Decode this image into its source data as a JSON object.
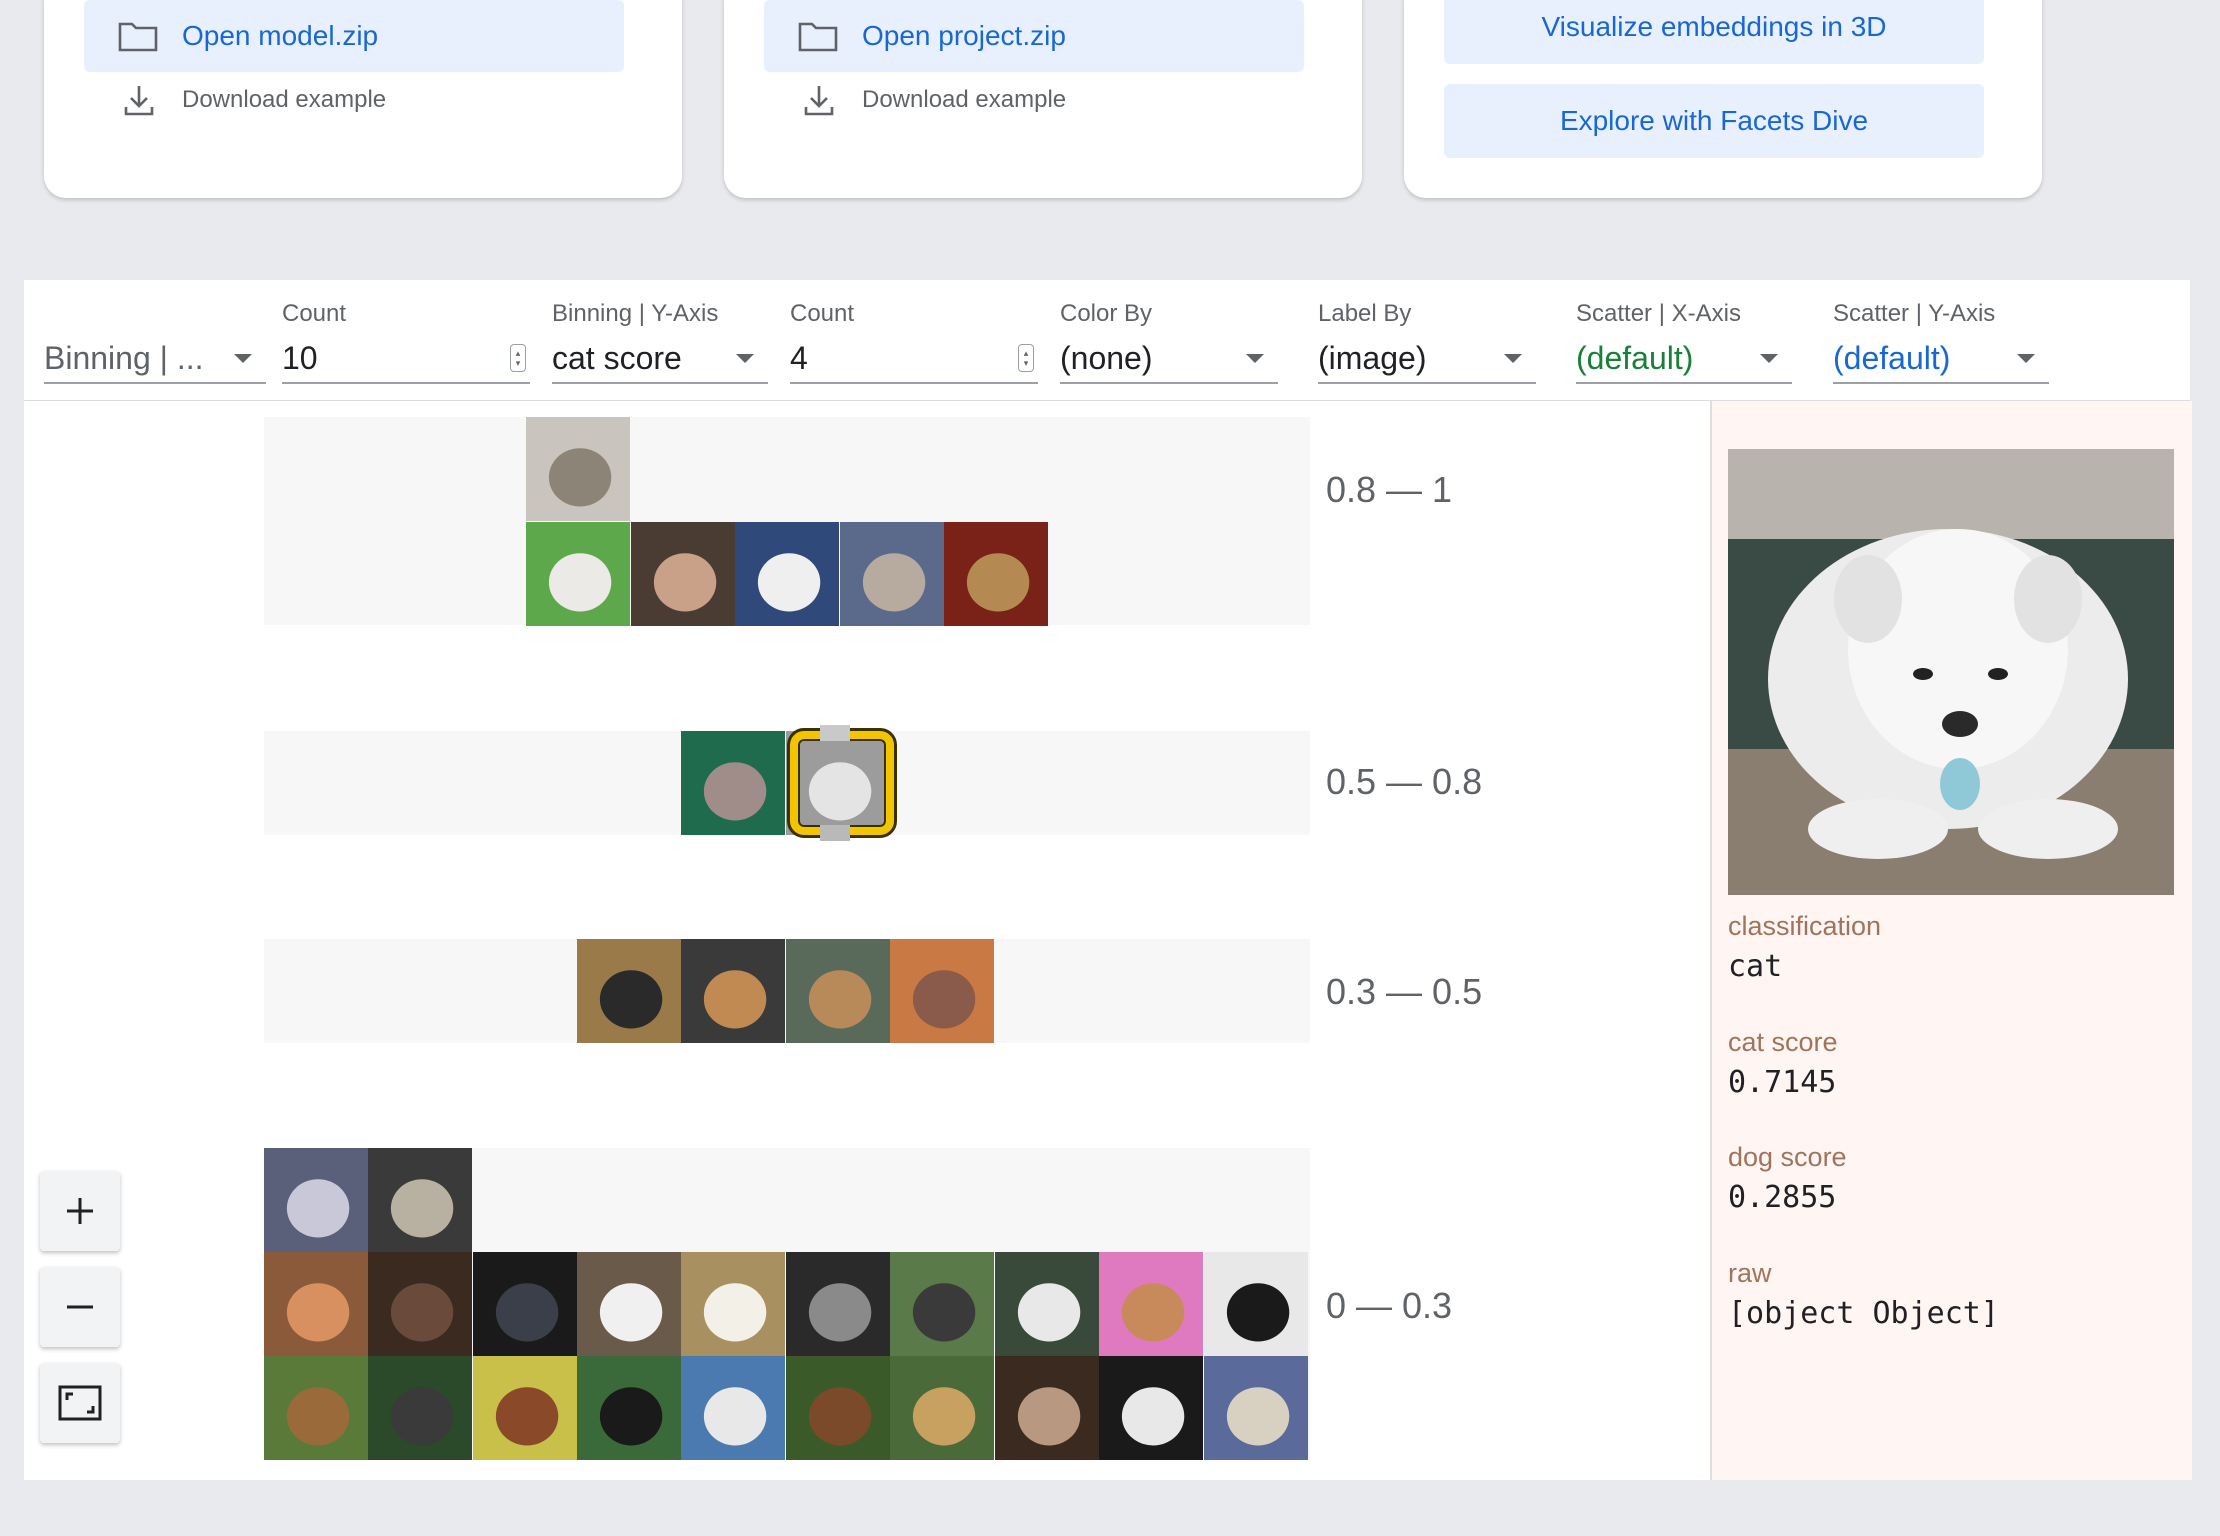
{
  "cards": [
    {
      "open_label": "Open model.zip",
      "download_label": "Download example"
    },
    {
      "open_label": "Open project.zip",
      "download_label": "Download example"
    },
    {
      "visualize_label": "Visualize embeddings in 3D",
      "facets_label": "Explore with Facets Dive"
    }
  ],
  "toolbar": {
    "binning_x": {
      "label": "",
      "value": "Binning | ..."
    },
    "count_x": {
      "label": "Count",
      "value": "10"
    },
    "binning_y": {
      "label": "Binning | Y-Axis",
      "value": "cat score"
    },
    "count_y": {
      "label": "Count",
      "value": "4"
    },
    "color_by": {
      "label": "Color By",
      "value": "(none)"
    },
    "label_by": {
      "label": "Label By",
      "value": "(image)"
    },
    "scatter_x": {
      "label": "Scatter | X-Axis",
      "value": "(default)"
    },
    "scatter_y": {
      "label": "Scatter | Y-Axis",
      "value": "(default)"
    }
  },
  "bins": [
    {
      "label": "0.8 — 1"
    },
    {
      "label": "0.5 — 0.8"
    },
    {
      "label": "0.3 — 0.5"
    },
    {
      "label": "0 — 0.3"
    }
  ],
  "zoom": {
    "in_icon": "plus-icon",
    "out_icon": "minus-icon",
    "fit_icon": "fit-screen-icon"
  },
  "details": {
    "fields": [
      {
        "key": "classification",
        "value": "cat"
      },
      {
        "key": "cat score",
        "value": "0.7145"
      },
      {
        "key": "dog score",
        "value": "0.2855"
      },
      {
        "key": "raw",
        "value": "[object Object]"
      }
    ]
  },
  "colors": {
    "accent": "#1967d2",
    "button_bg": "#e8f0fe",
    "selection": "#f3c400",
    "green_value": "#188038"
  }
}
